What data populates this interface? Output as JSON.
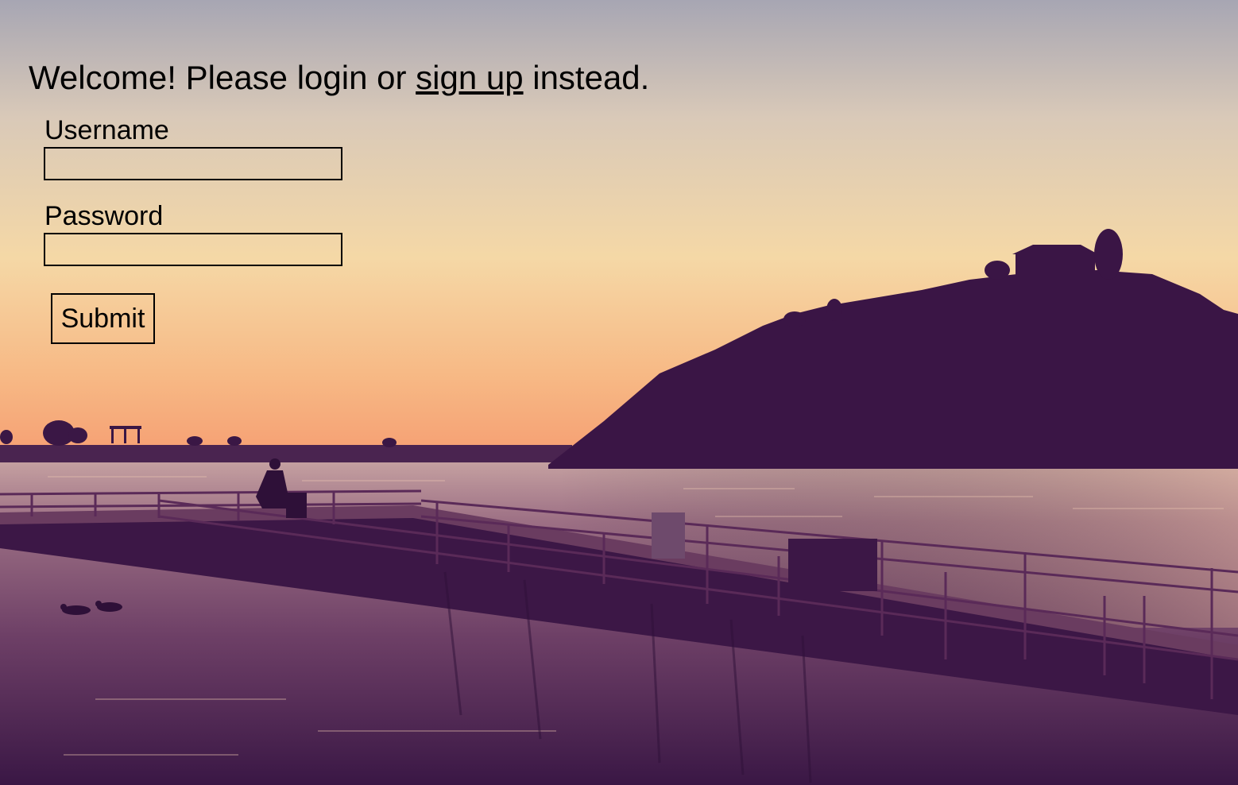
{
  "header": {
    "welcome_prefix": "Welcome! Please login or ",
    "signup_link": "sign up",
    "welcome_suffix": " instead."
  },
  "form": {
    "username_label": "Username",
    "username_value": "",
    "password_label": "Password",
    "password_value": "",
    "submit_label": "Submit"
  },
  "background": {
    "description_icon": "sunset-lake-pier-photo",
    "colors": {
      "sky_top": "#a9a7b4",
      "sky_mid": "#f4d3a3",
      "sky_horizon": "#f6a474",
      "hill": "#3a1545",
      "water_light": "#b98a92",
      "water_dark": "#3c1845"
    }
  }
}
